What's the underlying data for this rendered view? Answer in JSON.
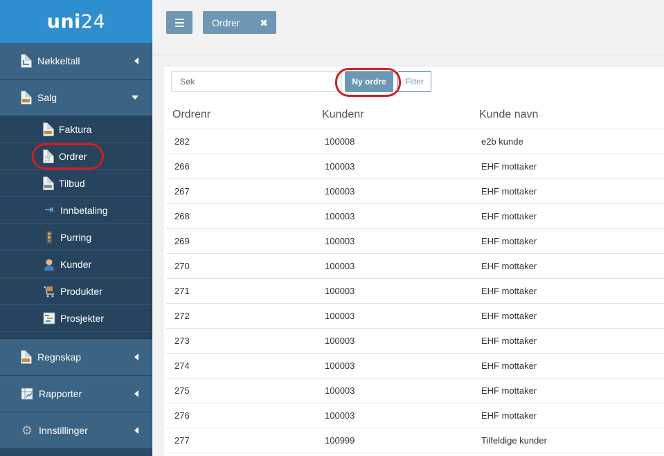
{
  "logo": {
    "bold": "uni",
    "light": "24"
  },
  "sidebar": {
    "top_items": [
      {
        "label": "Nøkkeltall",
        "icon": "dashboard-doc-icon"
      },
      {
        "label": "Salg",
        "icon": "sales-doc-icon",
        "expanded": true
      },
      {
        "label": "Regnskap",
        "icon": "accounting-icon"
      },
      {
        "label": "Rapporter",
        "icon": "reports-icon"
      },
      {
        "label": "Innstillinger",
        "icon": "gear-icon"
      }
    ],
    "sub_items": [
      {
        "label": "Faktura",
        "icon": "invoice-doc-icon"
      },
      {
        "label": "Ordrer",
        "icon": "order-doc-icon",
        "active": true
      },
      {
        "label": "Tilbud",
        "icon": "quote-doc-icon"
      },
      {
        "label": "Innbetaling",
        "icon": "payment-icon"
      },
      {
        "label": "Purring",
        "icon": "traffic-light-icon"
      },
      {
        "label": "Kunder",
        "icon": "customer-icon"
      },
      {
        "label": "Produkter",
        "icon": "product-cart-icon"
      },
      {
        "label": "Prosjekter",
        "icon": "project-icon"
      }
    ]
  },
  "topbar": {
    "tab_label": "Ordrer",
    "close_glyph": "✖"
  },
  "toolbar": {
    "search_placeholder": "Søk",
    "new_order_label": "Ny ordre",
    "filter_label": "Filter"
  },
  "table": {
    "headers": [
      "Ordrenr",
      "Kundenr",
      "Kunde navn"
    ],
    "rows": [
      [
        "282",
        "100008",
        "e2b kunde"
      ],
      [
        "266",
        "100003",
        "EHF mottaker"
      ],
      [
        "267",
        "100003",
        "EHF mottaker"
      ],
      [
        "268",
        "100003",
        "EHF mottaker"
      ],
      [
        "269",
        "100003",
        "EHF mottaker"
      ],
      [
        "270",
        "100003",
        "EHF mottaker"
      ],
      [
        "271",
        "100003",
        "EHF mottaker"
      ],
      [
        "272",
        "100003",
        "EHF mottaker"
      ],
      [
        "273",
        "100003",
        "EHF mottaker"
      ],
      [
        "274",
        "100003",
        "EHF mottaker"
      ],
      [
        "275",
        "100003",
        "EHF mottaker"
      ],
      [
        "276",
        "100003",
        "EHF mottaker"
      ],
      [
        "277",
        "100999",
        "Tilfeldige kunder"
      ]
    ]
  },
  "colors": {
    "sidebar_bg": "#2b4a66",
    "logo_bg": "#2e8fcf",
    "accent_button": "#6e97b4",
    "highlight_ring": "#d41d1d"
  }
}
